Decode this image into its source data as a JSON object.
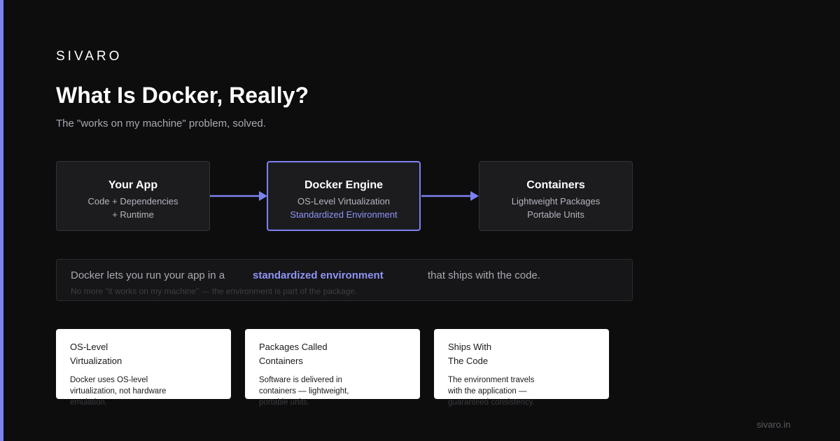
{
  "brand": "SIVARO",
  "title": "What Is Docker, Really?",
  "subtitle": "The \"works on my machine\" problem, solved.",
  "colors": {
    "accent": "#7c82f0",
    "background": "#0d0d0e",
    "node": "#1c1c1f",
    "card": "#ffffff"
  },
  "flow": {
    "nodes": [
      {
        "title": "Your App",
        "line1": "Code + Dependencies",
        "line2": "+ Runtime"
      },
      {
        "title": "Docker Engine",
        "line1": "OS-Level Virtualization",
        "line2": "Standardized Environment"
      },
      {
        "title": "Containers",
        "line1": "Lightweight Packages",
        "line2": "Portable Units"
      }
    ]
  },
  "callout": {
    "before": "Docker lets you run your app in a",
    "highlight": "standardized environment",
    "after": "that ships with the code.",
    "note": "No more \"it works on my machine\" — the environment is part of the package."
  },
  "cards": [
    {
      "title1": "OS-Level",
      "title2": "Virtualization",
      "desc1": "Docker uses OS-level",
      "desc2": "virtualization, not hardware",
      "desc3": "emulation."
    },
    {
      "title1": "Packages Called",
      "title2": "Containers",
      "desc1": "Software is delivered in",
      "desc2": "containers — lightweight,",
      "desc3": "portable units."
    },
    {
      "title1": "Ships With",
      "title2": "The Code",
      "desc1": "The environment travels",
      "desc2": "with the application —",
      "desc3": "guaranteed consistency."
    }
  ],
  "footer": "sivaro.in"
}
